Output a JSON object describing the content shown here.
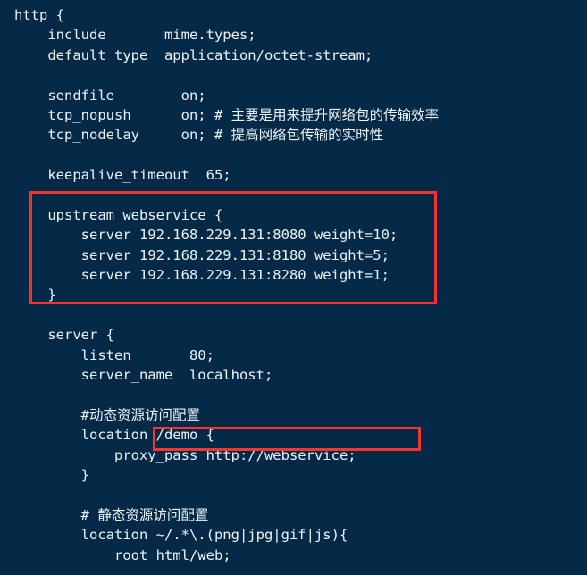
{
  "document": {
    "kind": "nginx-configuration-snippet",
    "background_color": "#042a47",
    "text_color": "#eef2f5",
    "highlight_color": "#f7332f",
    "lines": [
      "http {",
      "    include       mime.types;",
      "    default_type  application/octet-stream;",
      "",
      "    sendfile        on;",
      "    tcp_nopush      on; # 主要是用来提升网络包的传输效率",
      "    tcp_nodelay     on; # 提高网络包传输的实时性",
      "",
      "    keepalive_timeout  65;",
      "",
      "    upstream webservice {",
      "        server 192.168.229.131:8080 weight=10;",
      "        server 192.168.229.131:8180 weight=5;",
      "        server 192.168.229.131:8280 weight=1;",
      "    }",
      "",
      "    server {",
      "        listen       80;",
      "        server_name  localhost;",
      "",
      "        #动态资源访问配置",
      "        location /demo {",
      "            proxy_pass http://webservice;",
      "        }",
      "",
      "        # 静态资源访问配置",
      "        location ~/.*\\.(png|jpg|gif|js){",
      "            root html/web;",
      "        }"
    ]
  },
  "highlights": [
    {
      "id": "hl-upstream",
      "label": "upstream-webservice-block-highlight",
      "color": "#f7332f",
      "covers": "upstream webservice { ... }"
    },
    {
      "id": "hl-proxypass",
      "label": "proxy-pass-directive-highlight",
      "color": "#f7332f",
      "covers": "proxy_pass http://webservice;"
    }
  ]
}
